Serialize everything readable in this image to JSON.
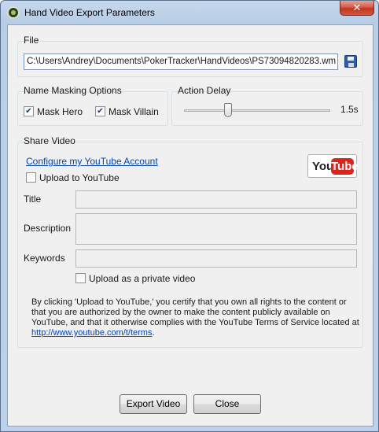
{
  "window": {
    "title": "Hand Video Export Parameters",
    "close_label": "✕"
  },
  "file": {
    "group_label": "File",
    "path_value": "C:\\Users\\Andrey\\Documents\\PokerTracker\\HandVideos\\PS73094820283.wm"
  },
  "masking": {
    "group_label": "Name Masking Options",
    "mask_hero_label": "Mask Hero",
    "mask_hero_checked": true,
    "mask_villain_label": "Mask Villain",
    "mask_villain_checked": true
  },
  "action_delay": {
    "group_label": "Action Delay",
    "value_text": "1.5s",
    "value_seconds": 1.5
  },
  "share": {
    "group_label": "Share Video",
    "configure_link": "Configure my YouTube Account",
    "upload_label": "Upload to YouTube",
    "upload_checked": false,
    "logo_you": "You",
    "logo_tube": "Tube",
    "title_label": "Title",
    "title_value": "",
    "description_label": "Description",
    "description_value": "",
    "keywords_label": "Keywords",
    "keywords_value": "",
    "private_label": "Upload as a private video",
    "private_checked": false,
    "notice_text": "By clicking 'Upload to YouTube,' you certify that you own all rights to the content or that you are authorized by the owner to make the content publicly available on YouTube, and that it otherwise complies with the YouTube Terms of Service located at",
    "terms_link": "http://www.youtube.com/t/terms",
    "notice_end": "."
  },
  "buttons": {
    "export_label": "Export Video",
    "close_label": "Close"
  },
  "colors": {
    "link": "#0645ad",
    "youtube_red": "#d9251c",
    "title_bar": "#b9cfe7",
    "close_button": "#c2351f"
  }
}
